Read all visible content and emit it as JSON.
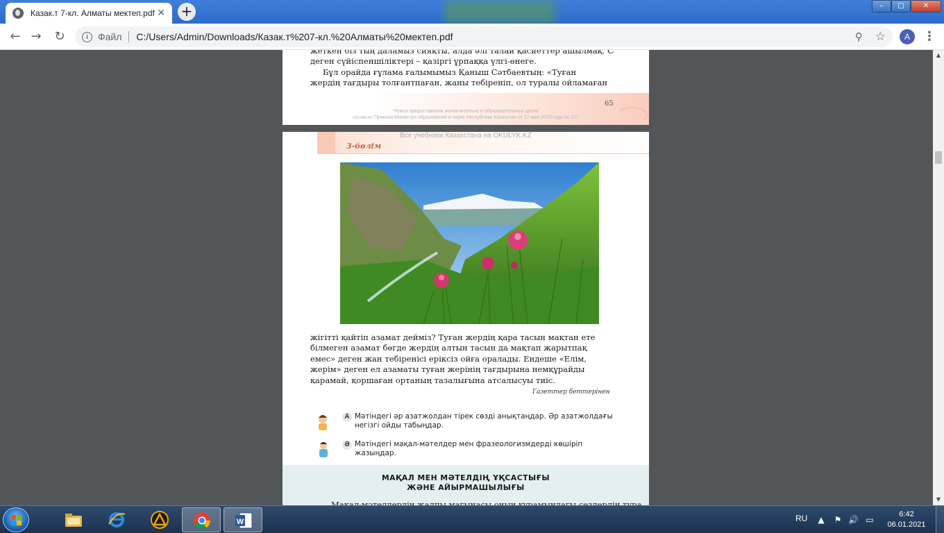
{
  "browser": {
    "tab_title": "Казак.т 7-кл. Алматы мектеп.pdf",
    "new_tab_label": "+",
    "back_icon": "arrow-left-icon",
    "forward_icon": "arrow-right-icon",
    "reload_icon": "reload-icon",
    "scheme_label": "Файл",
    "url": "C:/Users/Admin/Downloads/Казак.т%207-кл.%20Алматы%20мектеп.pdf",
    "avatar_letter": "A"
  },
  "pdf": {
    "page1": {
      "lines": [
        "жеткен біз тың даламыз сияқты, алда әлі талай қасиеттер ашылмақ. Сондай-ақ",
        "деген сүйіспеншіліктері – қазіргі ұрпаққа үлгі-өнеге.",
        "Бұл орайда ғұлама ғалымымыз Қаныш Сәтбаевтың: «Туған",
        "жердің тағдыры толғантпаған, жаны тебіреніп, ол туралы ойламаған"
      ],
      "page_number": "65",
      "watermark_line1": "*Книга предоставлена исключительно в образовательных целях",
      "watermark_line2": "согласно Приказа Министра образования и науки Республики Казахстан от 17 мая 2019 года № 217"
    },
    "page2": {
      "top_watermark": "Все учебники Казахстана на OKULYK.KZ",
      "section_label": "3-бөлім",
      "paragraph": [
        "жігітті қайтіп азамат дейміз? Туған жердің қара тасын мақтан ете",
        "білмеген азамат бөгде жердің алтын тасын да мақтап жарытпақ",
        "емес» деген жан тебіренісі еріксіз ойға оралады. Ендеше «Елім,",
        "жерім» деген ел азаматы туған жерінің тағдырына немқұрайды",
        "қарамай, қоршаған ортаның тазалығына атсалысуы тиіс."
      ],
      "attribution": "Газеттер беттерінен",
      "tasks": [
        {
          "letter": "А",
          "text": "Мәтіндегі әр азатжолдан тірек сөзді анықтаңдар. Әр азатжолдағы негізгі ойды табыңдар."
        },
        {
          "letter": "Ә",
          "text": "Мәтіндегі мақал-мәтелдер мен фразеологизмдерді көшіріп жазыңдар."
        }
      ],
      "rule_title_line1": "МАҚАЛ МЕН МӘТЕЛДІҢ ҰҚСАСТЫҒЫ",
      "rule_title_line2": "ЖӘНЕ АЙЫРМАШЫЛЫҒЫ",
      "rule_body_start": "Мақал-мәтелдердің жалпы мағынасы оның құрамындағы сөздердің тура"
    }
  },
  "taskbar": {
    "apps": [
      "windows-explorer",
      "internet-explorer",
      "archicad",
      "chrome",
      "word"
    ],
    "language": "RU",
    "time": "6:42",
    "date": "06.01.2021"
  }
}
